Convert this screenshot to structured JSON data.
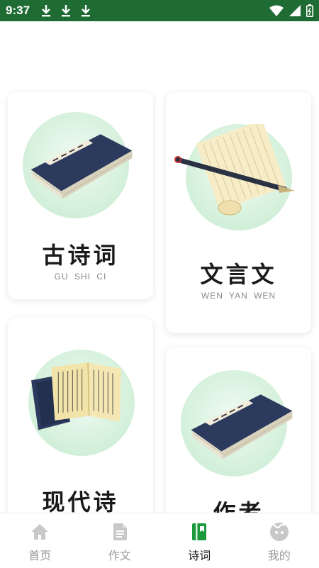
{
  "status_bar": {
    "time": "9:37"
  },
  "cards": [
    {
      "title": "古诗词",
      "pinyin": "GU SHI CI"
    },
    {
      "title": "文言文",
      "pinyin": "WEN YAN WEN"
    },
    {
      "title": "现代诗",
      "pinyin": ""
    },
    {
      "title": "作者",
      "pinyin": ""
    }
  ],
  "nav": [
    {
      "label": "首页",
      "icon": "home-icon"
    },
    {
      "label": "作文",
      "icon": "document-icon"
    },
    {
      "label": "诗词",
      "icon": "book-icon",
      "active": true
    },
    {
      "label": "我的",
      "icon": "profile-icon"
    }
  ],
  "colors": {
    "status_bar": "#1e6b33",
    "nav_active": "#1a9a3c",
    "nav_inactive": "#c8c8c8",
    "book_cover": "#2c3a5e",
    "circle_green": "#cdeed5"
  }
}
